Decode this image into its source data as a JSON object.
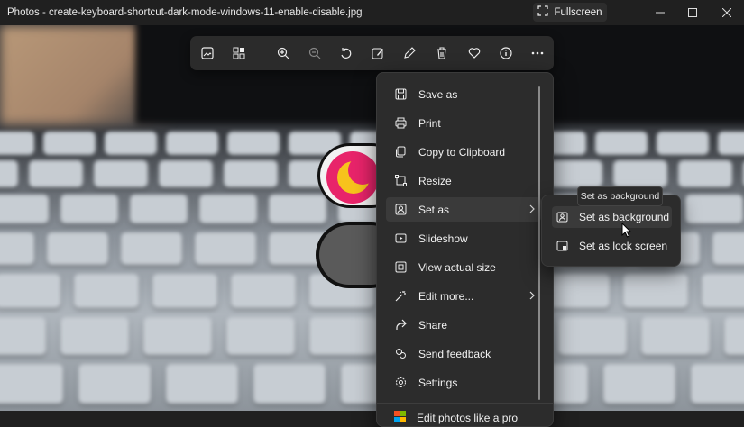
{
  "window": {
    "title": "Photos - create-keyboard-shortcut-dark-mode-windows-11-enable-disable.jpg",
    "fullscreen_label": "Fullscreen"
  },
  "toolbar": {
    "items": [
      {
        "name": "view-icon"
      },
      {
        "name": "gallery-icon"
      },
      {
        "name": "zoom-in-icon"
      },
      {
        "name": "zoom-out-icon"
      },
      {
        "name": "rotate-icon"
      },
      {
        "name": "edit-image-icon"
      },
      {
        "name": "draw-icon"
      },
      {
        "name": "delete-icon"
      },
      {
        "name": "favorite-icon"
      },
      {
        "name": "info-icon"
      },
      {
        "name": "more-icon"
      }
    ]
  },
  "context_menu": {
    "items": [
      {
        "label": "Save as",
        "icon": "save-icon"
      },
      {
        "label": "Print",
        "icon": "print-icon"
      },
      {
        "label": "Copy to Clipboard",
        "icon": "copy-icon"
      },
      {
        "label": "Resize",
        "icon": "resize-icon"
      },
      {
        "label": "Set as",
        "icon": "set-as-icon",
        "has_submenu": true,
        "active": true
      },
      {
        "label": "Slideshow",
        "icon": "slideshow-icon"
      },
      {
        "label": "View actual size",
        "icon": "actual-size-icon"
      },
      {
        "label": "Edit more...",
        "icon": "edit-more-icon",
        "has_submenu": true
      },
      {
        "label": "Share",
        "icon": "share-icon"
      },
      {
        "label": "Send feedback",
        "icon": "feedback-icon"
      },
      {
        "label": "Settings",
        "icon": "settings-icon"
      }
    ],
    "footer_label": "Edit photos like a pro"
  },
  "submenu": {
    "tooltip": "Set as background",
    "items": [
      {
        "label": "Set as background",
        "icon": "background-icon",
        "hover": true
      },
      {
        "label": "Set as lock screen",
        "icon": "lock-screen-icon"
      }
    ]
  },
  "colors": {
    "menu_bg": "#2c2c2c",
    "titlebar_bg": "#202020",
    "moon_pink": "#e8246a",
    "moon_yellow": "#f7c31c"
  }
}
